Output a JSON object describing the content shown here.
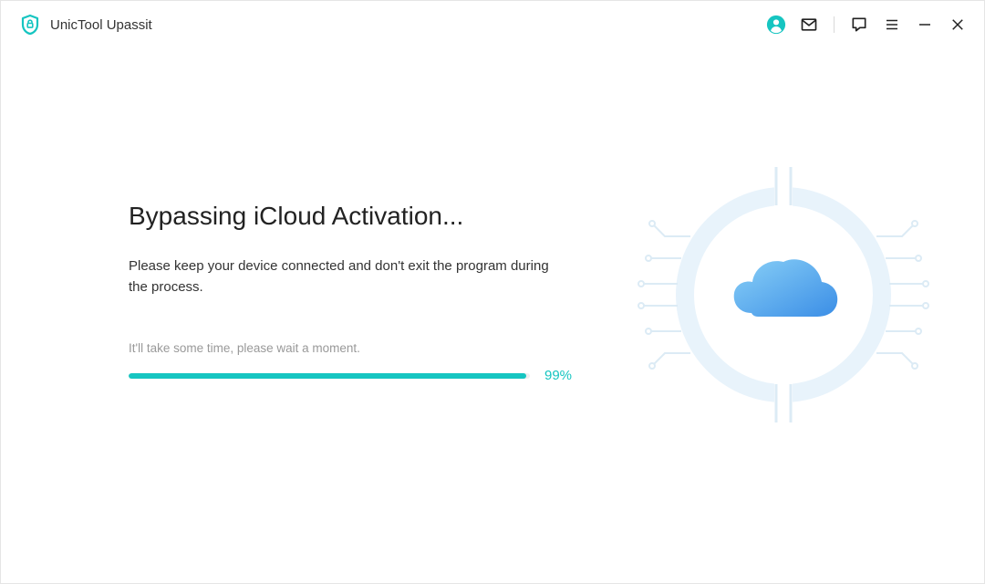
{
  "app": {
    "title": "UnicTool Upassit"
  },
  "main": {
    "heading": "Bypassing iCloud Activation...",
    "subtext": "Please keep your device connected and don't exit the program during the process.",
    "hint": "It'll take some time, please wait a moment.",
    "progress_pct_label": "99%",
    "progress_pct_value": 99
  },
  "icons": {
    "account": "account-icon",
    "mail": "mail-icon",
    "chat": "chat-icon",
    "menu": "menu-icon",
    "minimize": "minimize-icon",
    "close": "close-icon"
  },
  "colors": {
    "accent": "#16c5c1",
    "brand_blue": "#3ca8e6"
  }
}
